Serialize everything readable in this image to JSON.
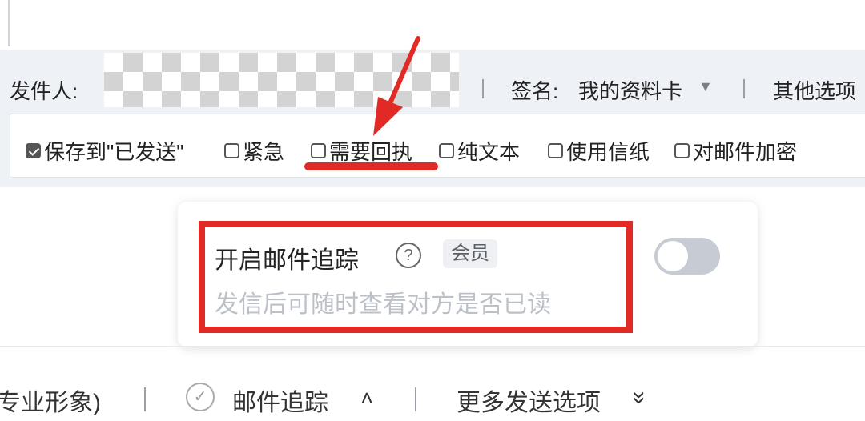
{
  "header": {
    "sender_label": "发件人:",
    "signature_label": "签名:",
    "signature_value": "我的资料卡",
    "dropdown_arrow": "▼",
    "other_options_label": "其他选项"
  },
  "options": [
    {
      "label": "保存到\"已发送\"",
      "checked": true
    },
    {
      "label": "紧急",
      "checked": false
    },
    {
      "label": "需要回执",
      "checked": false
    },
    {
      "label": "纯文本",
      "checked": false
    },
    {
      "label": "使用信纸",
      "checked": false
    },
    {
      "label": "对邮件加密",
      "checked": false
    }
  ],
  "tracking_popup": {
    "title": "开启邮件追踪",
    "help_icon_text": "?",
    "badge": "会员",
    "description": "发信后可随时查看对方是否已读",
    "toggle_on": false
  },
  "bottom_bar": {
    "left_text": "专业形象)",
    "check_icon": "✓",
    "tracking_label": "邮件追踪",
    "tracking_caret": "˄",
    "more_options_label": "更多发送选项",
    "more_options_icon": "»"
  },
  "colors": {
    "annotation_red": "#e12a26",
    "bar_background": "#eef1f6"
  }
}
